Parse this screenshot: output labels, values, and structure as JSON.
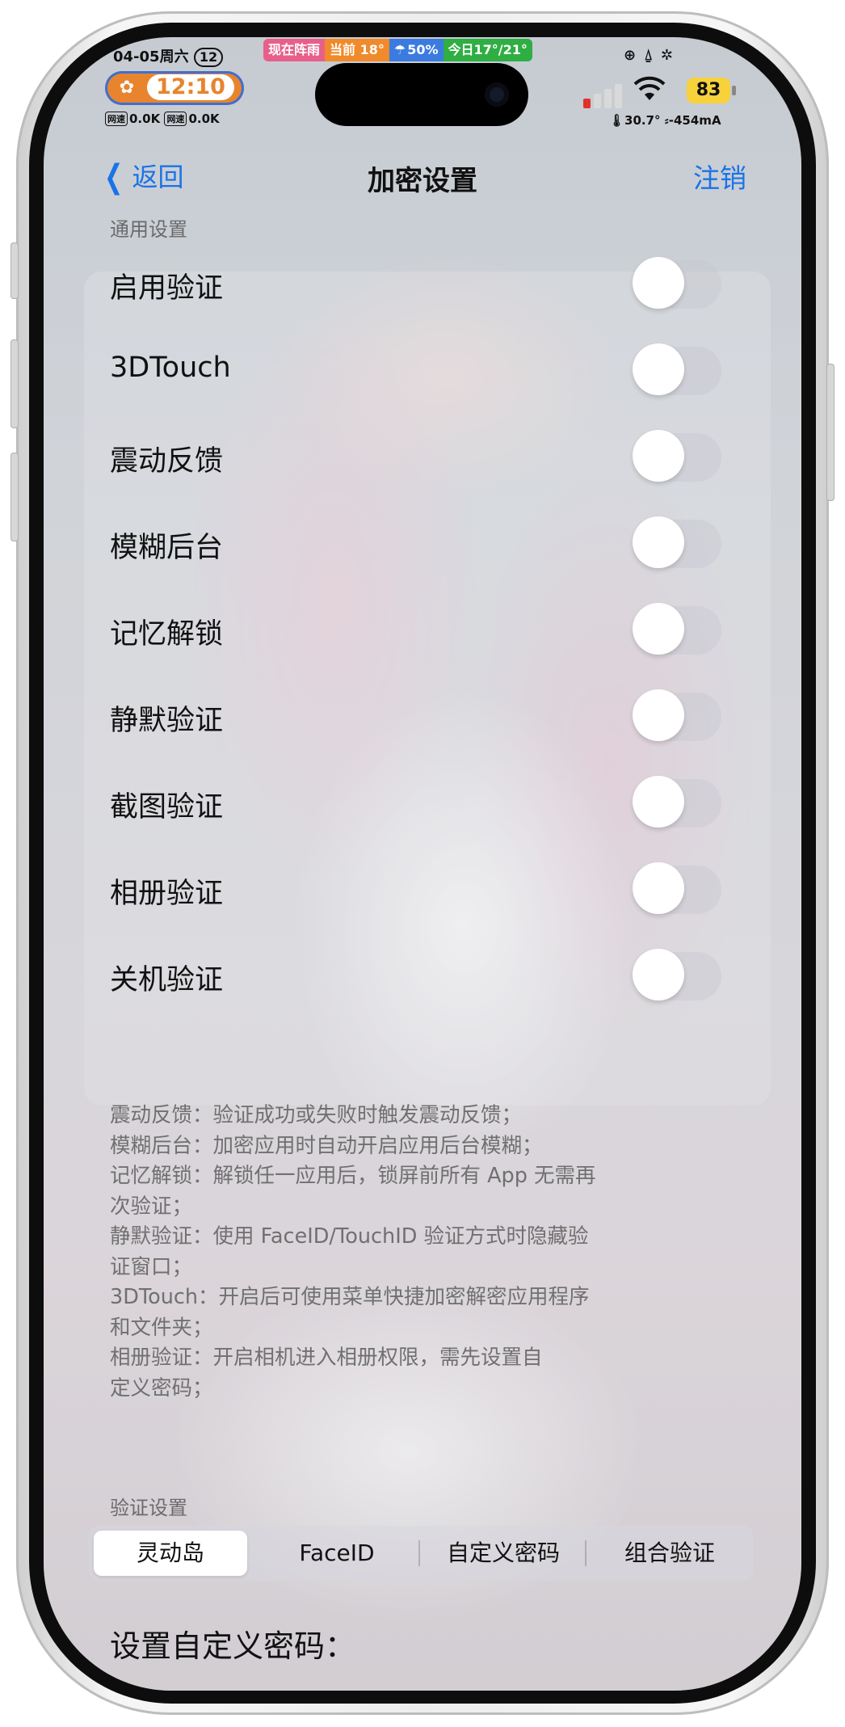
{
  "status_bar": {
    "date": "04-05周六",
    "date_badge": "12",
    "time": "12:10",
    "net_label": "网速",
    "net_up": "0.0K",
    "net_down": "0.0K",
    "weather_1": "现在阵雨",
    "weather_2": "当前 18°",
    "weather_3": "50%",
    "weather_4": "今日17°/21°",
    "battery": "83",
    "battery_info": "30.7° ⸗-454mA"
  },
  "nav": {
    "back_label": "返回",
    "title": "加密设置",
    "right_label": "注销"
  },
  "general_header": "通用设置",
  "toggles": [
    {
      "label": "启用验证"
    },
    {
      "label": "3DTouch"
    },
    {
      "label": "震动反馈"
    },
    {
      "label": "模糊后台"
    },
    {
      "label": "记忆解锁"
    },
    {
      "label": "静默验证"
    },
    {
      "label": "截图验证"
    },
    {
      "label": "相册验证"
    },
    {
      "label": "关机验证"
    }
  ],
  "description_lines": [
    "震动反馈：验证成功或失败时触发震动反馈；",
    "模糊后台：加密应用时自动开启应用后台模糊；",
    "记忆解锁：解锁任一应用后，锁屏前所有 App 无需再",
    "次验证；",
    "静默验证：使用 FaceID/TouchID 验证方式时隐藏验",
    "证窗口；",
    "3DTouch：开启后可使用菜单快捷加密解密应用程序",
    "和文件夹；",
    "相册验证：开启相机进入相册权限，需先设置自",
    "定义密码；"
  ],
  "verify_header": "验证设置",
  "segments": [
    {
      "label": "灵动岛",
      "selected": true
    },
    {
      "label": "FaceID",
      "selected": false
    },
    {
      "label": "自定义密码",
      "selected": false
    },
    {
      "label": "组合验证",
      "selected": false
    }
  ],
  "bottom_title": "设置自定义密码："
}
